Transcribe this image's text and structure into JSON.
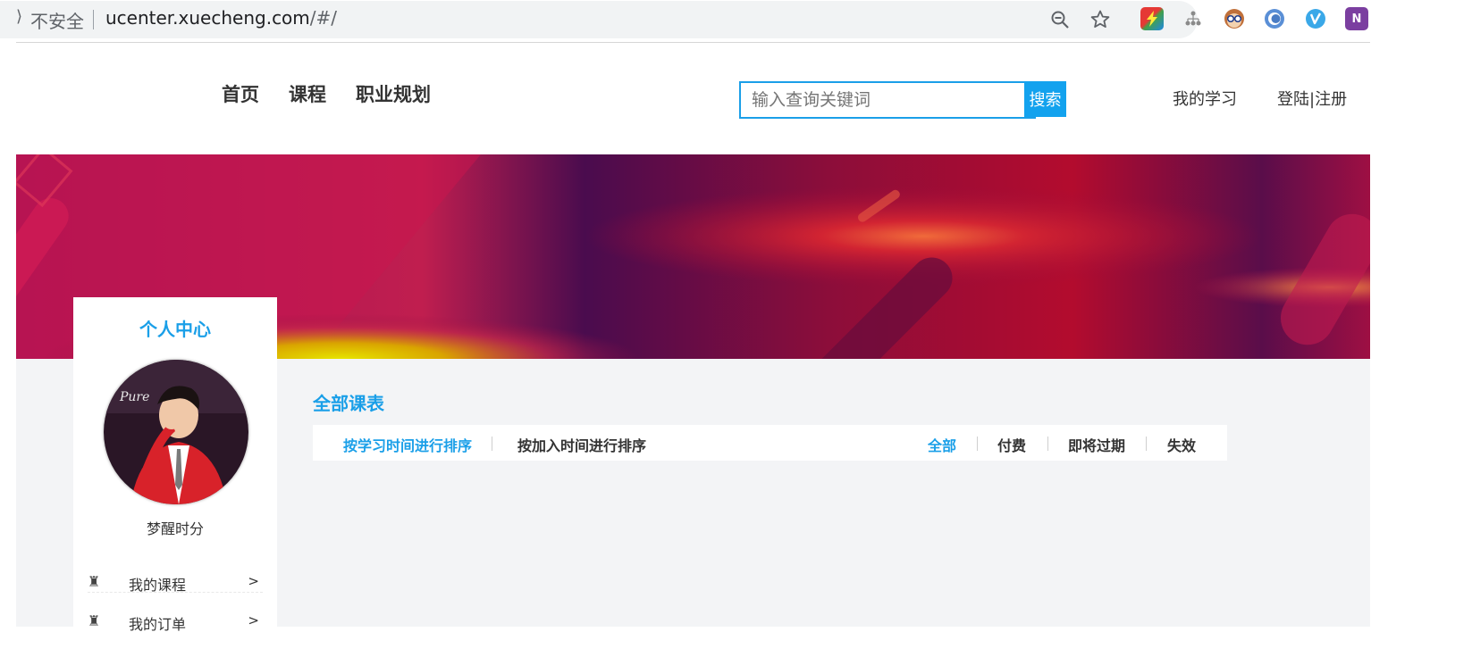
{
  "browser": {
    "secure_label": "不安全",
    "url_host": "ucenter.xuecheng.com",
    "url_path": "/#/",
    "icons": [
      "zoom-out-icon",
      "bookmark-star-icon",
      "extension-bolt-icon",
      "extension-tree-icon",
      "extension-glasses-icon",
      "extension-circle-icon",
      "extension-v-icon",
      "onenote-icon"
    ]
  },
  "header": {
    "nav": [
      "首页",
      "课程",
      "职业规划"
    ],
    "search": {
      "placeholder": "输入查询关键词",
      "button": "搜索"
    },
    "links": {
      "my_learning": "我的学习",
      "login": "登陆|注册"
    }
  },
  "sidebar": {
    "title": "个人中心",
    "username": "梦醒时分",
    "avatar_text": "Pure",
    "menu": [
      {
        "icon": "rook-icon",
        "label": "我的课程",
        "arrow": ">"
      },
      {
        "icon": "rook-icon",
        "label": "我的订单",
        "arrow": ">"
      }
    ]
  },
  "courses": {
    "title": "全部课表",
    "sort_options": [
      "按学习时间进行排序",
      "按加入时间进行排序"
    ],
    "filters": [
      "全部",
      "付费",
      "即将过期",
      "失效"
    ]
  },
  "colors": {
    "accent": "#1a9fe8",
    "search_button": "#13a2ee",
    "banner": "#7a0d42"
  }
}
